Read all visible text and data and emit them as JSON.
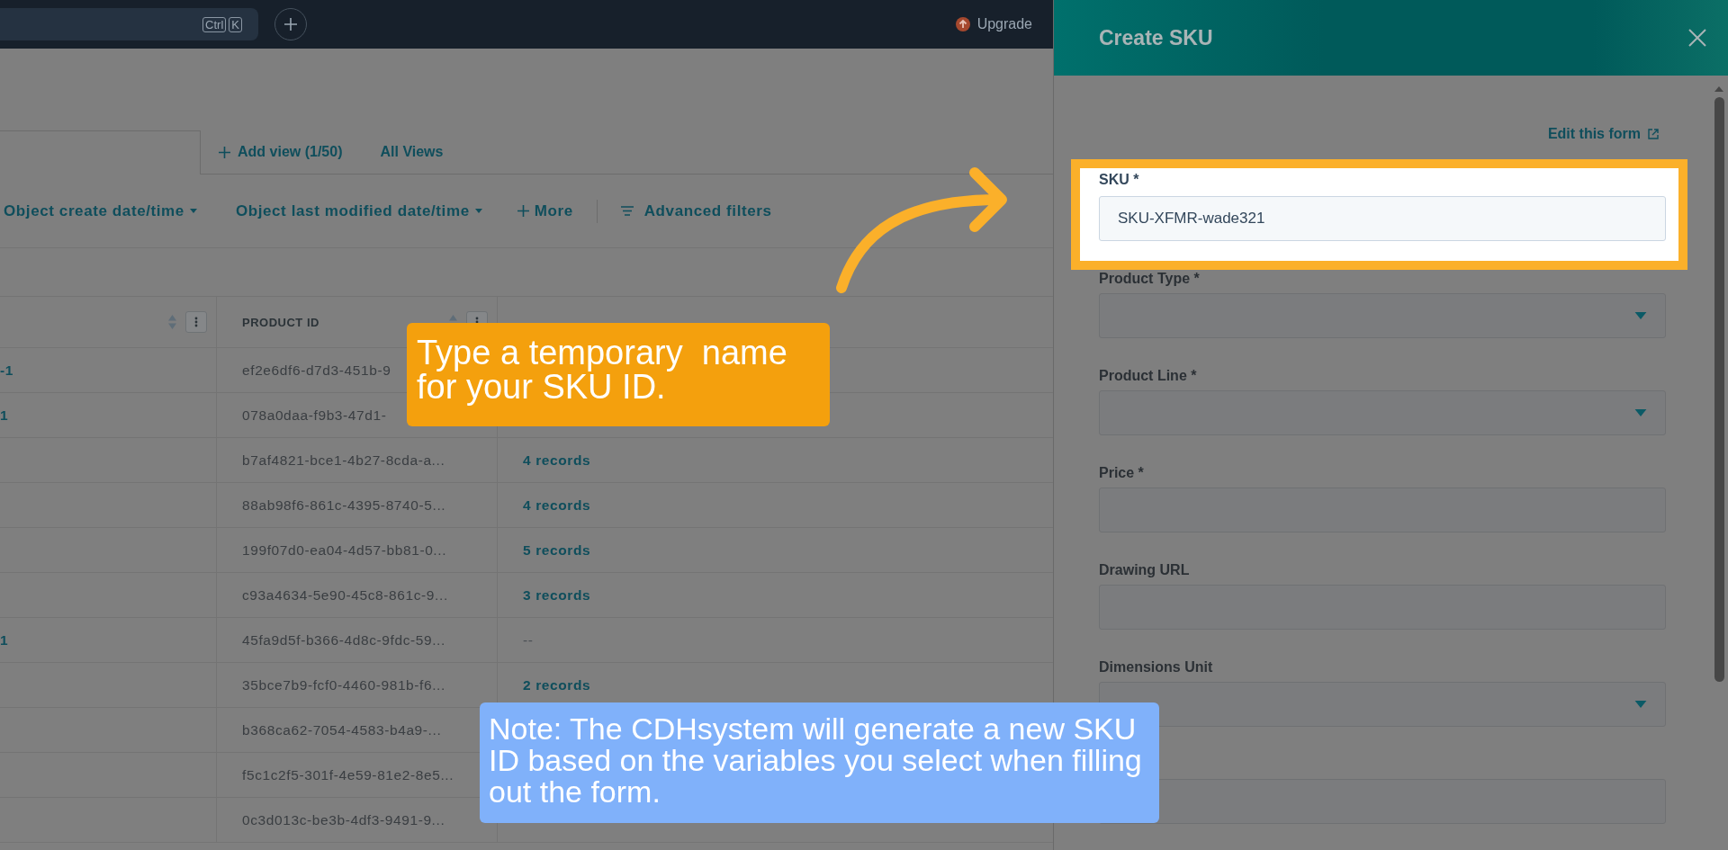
{
  "top_bar": {
    "shortcut_keys": [
      "Ctrl",
      "K"
    ],
    "upgrade": "Upgrade"
  },
  "view_tabs": [
    {
      "kind": "add",
      "label": "Add view (1/50)"
    },
    {
      "kind": "link",
      "label": "All Views"
    }
  ],
  "filters": [
    {
      "kind": "dropdown",
      "label": "Object create date/time"
    },
    {
      "kind": "dropdown",
      "label": "Object last modified date/time"
    },
    {
      "kind": "add",
      "label": "More"
    },
    {
      "kind": "advanced",
      "label": "Advanced filters"
    }
  ],
  "table": {
    "product_id_header": "PRODUCT ID",
    "rows": [
      {
        "column_1": "-1",
        "product_id": "ef2e6df6-d7d3-451b-9"
      },
      {
        "column_1": "1",
        "product_id": "078a0daa-f9b3-47d1-"
      },
      {
        "product_id": "b7af4821-bce1-4b27-8cda-a...",
        "equipment_orders": {
          "text": "4 records",
          "link": true
        }
      },
      {
        "product_id": "88ab98f6-861c-4395-8740-5...",
        "equipment_orders": {
          "text": "4 records",
          "link": true
        }
      },
      {
        "product_id": "199f07d0-ea04-4d57-bb81-0...",
        "equipment_orders": {
          "text": "5 records",
          "link": true
        }
      },
      {
        "product_id": "c93a4634-5e90-45c8-861c-9...",
        "equipment_orders": {
          "text": "3 records",
          "link": true
        }
      },
      {
        "column_1": "1",
        "product_id": "45fa9d5f-b366-4d8c-9fdc-59...",
        "equipment_orders": {
          "text": "--",
          "link": false
        }
      },
      {
        "product_id": "35bce7b9-fcf0-4460-981b-f6...",
        "equipment_orders": {
          "text": "2 records",
          "link": true
        }
      },
      {
        "product_id": "b368ca62-7054-4583-b4a9-..."
      },
      {
        "product_id": "f5c1c2f5-301f-4e59-81e2-8e5..."
      },
      {
        "product_id": "0c3d013c-be3b-4df3-9491-9..."
      }
    ]
  },
  "panel": {
    "title": "Create SKU",
    "edit_link": "Edit this form",
    "fields": [
      {
        "kind": "text",
        "label": "SKU *",
        "value": "SKU-XFMR-wade321",
        "highlighted": true
      },
      {
        "kind": "select",
        "label": "Product Type *",
        "highlighted": false
      },
      {
        "kind": "select",
        "label": "Product Line *",
        "highlighted": false
      },
      {
        "kind": "text",
        "label": "Price *",
        "highlighted": false
      },
      {
        "kind": "text",
        "label": "Drawing URL",
        "highlighted": false
      },
      {
        "kind": "select",
        "label": "Dimensions Unit",
        "highlighted": false
      },
      {
        "kind": "text",
        "highlighted": false
      }
    ]
  },
  "callouts": [
    {
      "text": "Type a temporary  name for your SKU ID.",
      "color": "#f4a00d"
    },
    {
      "text": "Note: The CDHsystem will generate a new SKU ID based on the variables you select when filling out the form.",
      "color": "#80b1fa"
    }
  ]
}
